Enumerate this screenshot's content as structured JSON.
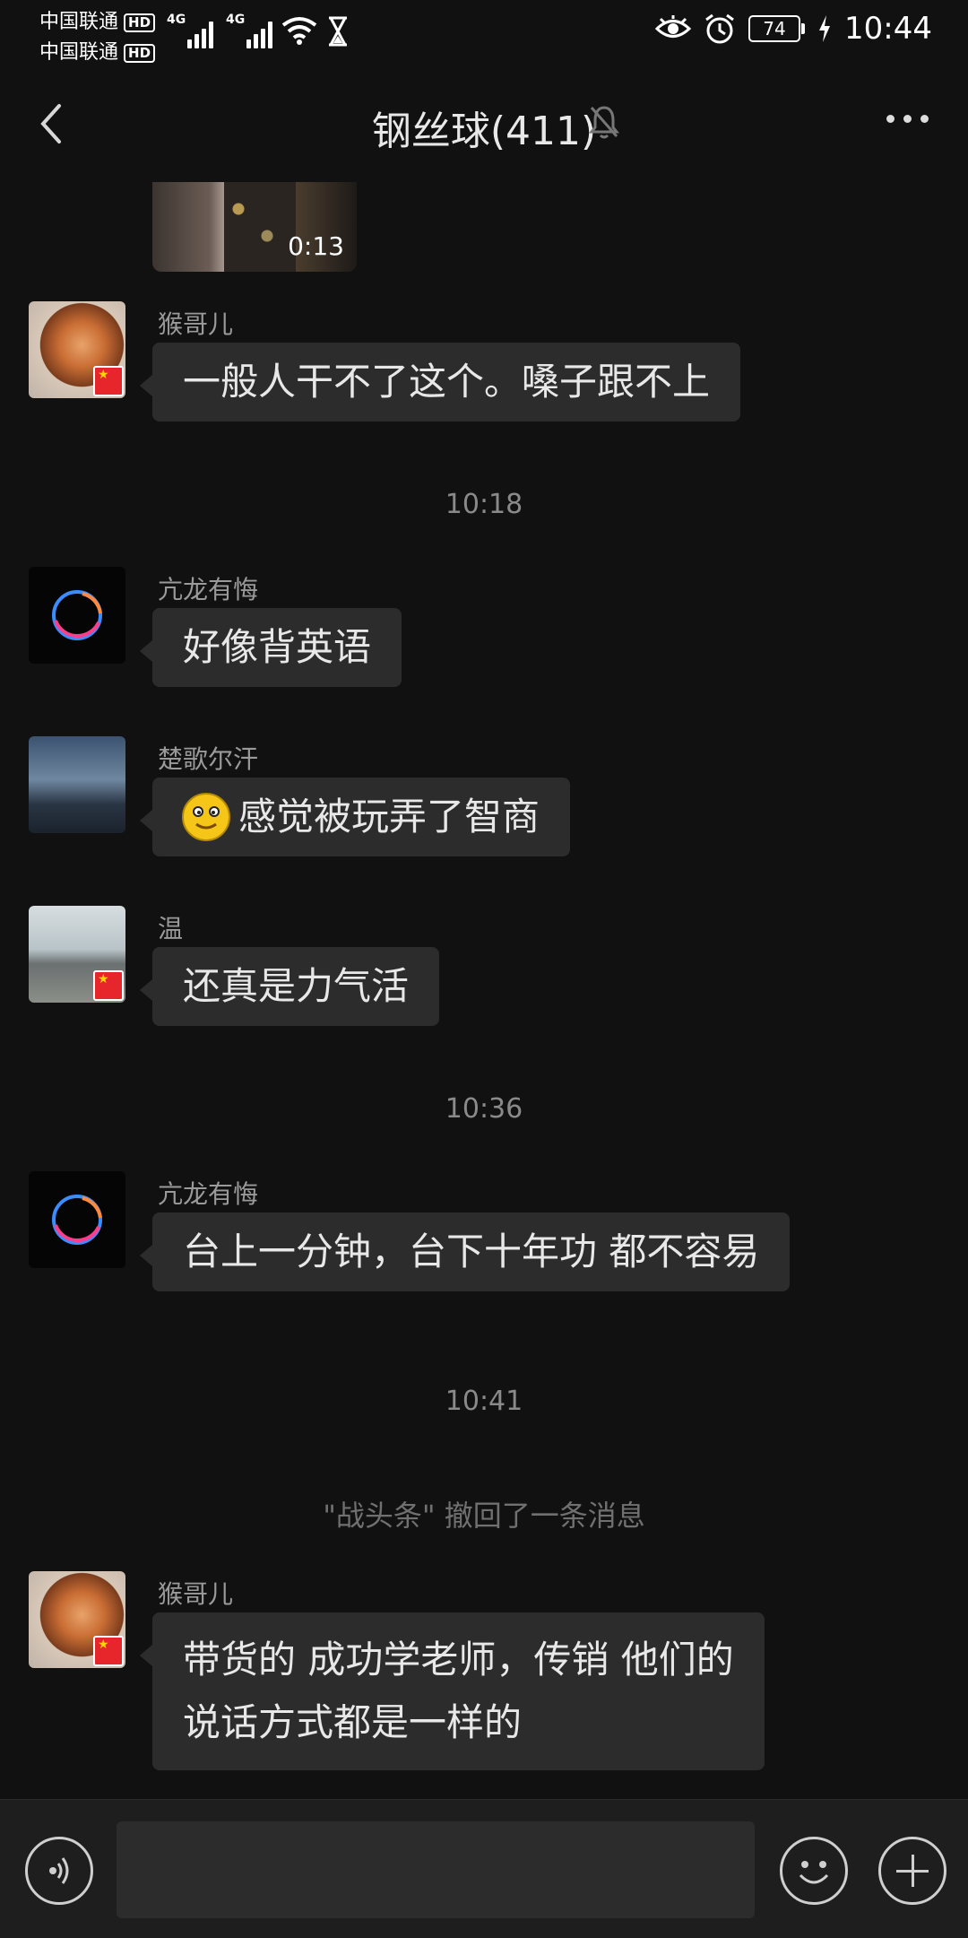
{
  "status_bar": {
    "carrier1": "中国联通",
    "carrier2": "中国联通",
    "hd_label": "HD",
    "net_label": "4G",
    "battery": "74",
    "time": "10:44"
  },
  "header": {
    "title": "钢丝球(411)"
  },
  "video": {
    "duration": "0:13"
  },
  "messages": [
    {
      "sender": "猴哥儿",
      "text": "一般人干不了这个。嗓子跟不上"
    },
    {
      "sender": "亢龙有悔",
      "text": "好像背英语"
    },
    {
      "sender": "楚歌尔汗",
      "text": "感觉被玩弄了智商"
    },
    {
      "sender": "温",
      "text": "还真是力气活"
    },
    {
      "sender": "亢龙有悔",
      "text": "台上一分钟，台下十年功 都不容易"
    },
    {
      "sender": "猴哥儿",
      "line1": "带货的 成功学老师，传销  他们的",
      "line2": "说话方式都是一样的"
    }
  ],
  "timestamps": [
    "10:18",
    "10:36",
    "10:41"
  ],
  "system_notice": "\"战头条\" 撤回了一条消息",
  "icons": {
    "back": "chevron-left-icon",
    "mute": "bell-off-icon",
    "more": "more-dots-icon",
    "voice": "voice-icon",
    "emoji": "emoji-icon",
    "plus": "plus-icon"
  }
}
